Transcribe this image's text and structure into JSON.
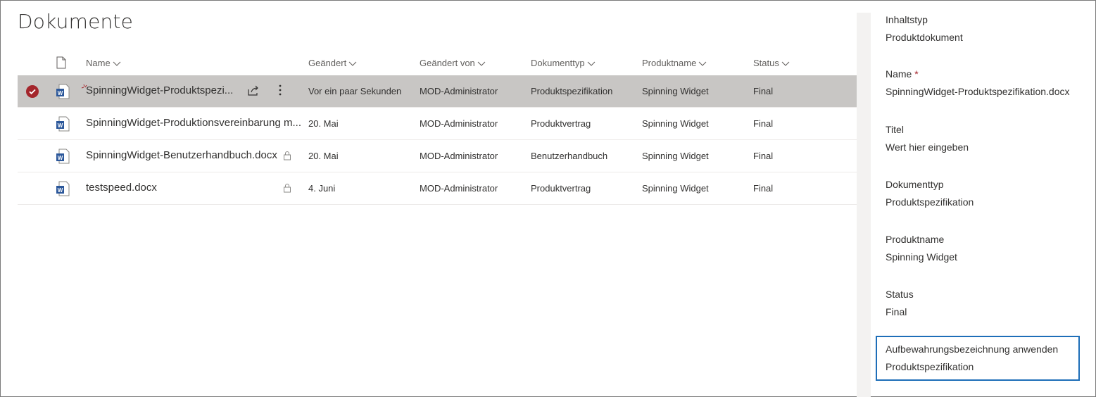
{
  "library": {
    "title": "Dokumente",
    "columns": {
      "name": "Name",
      "modified": "Geändert",
      "modified_by": "Geändert von",
      "doc_type": "Dokumenttyp",
      "product_name": "Produktname",
      "status": "Status"
    },
    "rows": [
      {
        "name": "SpinningWidget-Produktspezi...",
        "modified": "Vor ein paar Sekunden",
        "modified_by": "MOD-Administrator",
        "doc_type": "Produktspezifikation",
        "product_name": "Spinning Widget",
        "status": "Final"
      },
      {
        "name": "SpinningWidget-Produktionsvereinbarung m...",
        "modified": "20. Mai",
        "modified_by": "MOD-Administrator",
        "doc_type": "Produktvertrag",
        "product_name": "Spinning Widget",
        "status": "Final"
      },
      {
        "name": "SpinningWidget-Benutzerhandbuch.docx",
        "modified": "20. Mai",
        "modified_by": "MOD-Administrator",
        "doc_type": "Benutzerhandbuch",
        "product_name": "Spinning Widget",
        "status": "Final"
      },
      {
        "name": "testspeed.docx",
        "modified": "4. Juni",
        "modified_by": "MOD-Administrator",
        "doc_type": "Produktvertrag",
        "product_name": "Spinning Widget",
        "status": "Final"
      }
    ]
  },
  "details": {
    "content_type": {
      "label": "Inhaltstyp",
      "value": "Produktdokument"
    },
    "name": {
      "label": "Name",
      "required_mark": "*",
      "value": "SpinningWidget-Produktspezifikation.docx"
    },
    "title": {
      "label": "Titel",
      "placeholder": "Wert hier eingeben"
    },
    "doc_type": {
      "label": "Dokumenttyp",
      "value": "Produktspezifikation"
    },
    "product_name": {
      "label": "Produktname",
      "value": "Spinning Widget"
    },
    "status": {
      "label": "Status",
      "value": "Final"
    },
    "retention_label": {
      "label": "Aufbewahrungsbezeichnung anwenden",
      "value": "Produktspezifikation"
    }
  },
  "colors": {
    "selected_row": "#c8c6c4",
    "check_accent": "#a4262c",
    "word_blue": "#2b579a",
    "highlight_border": "#1e6eb8"
  }
}
